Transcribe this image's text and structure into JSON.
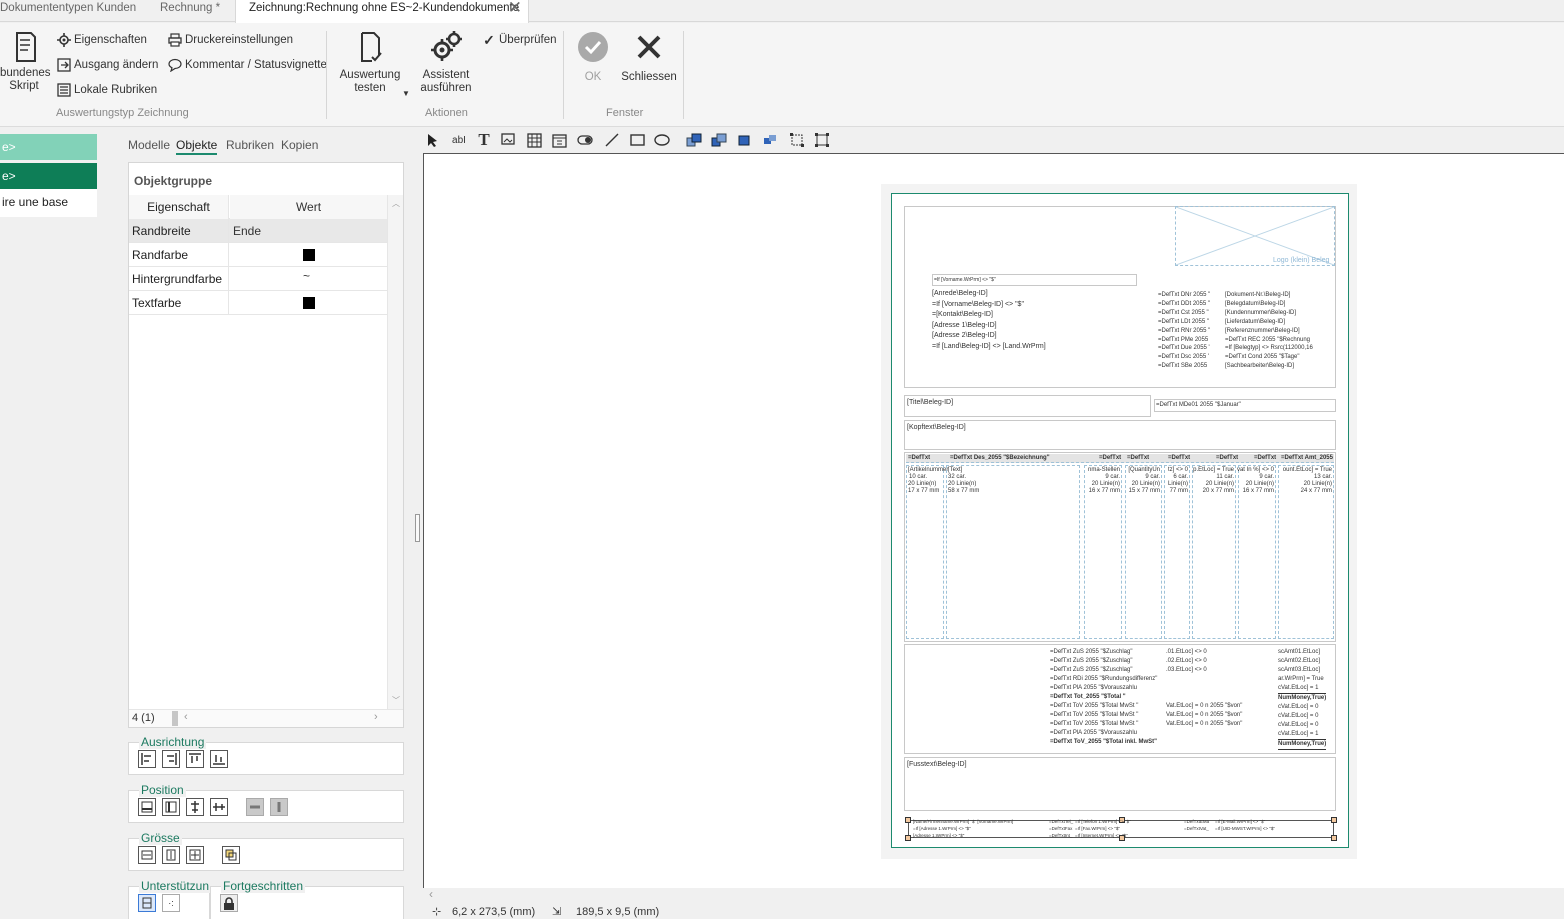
{
  "tabs": [
    {
      "label": "Dokumententypen Kunden"
    },
    {
      "label": "Rechnung *"
    },
    {
      "label": "Zeichnung:Rechnung ohne ES~2-Kundendokumente"
    }
  ],
  "ribbon": {
    "script_label": "bundenes\nSkript",
    "eigenschaften": "Eigenschaften",
    "ausgang_aendern": "Ausgang ändern",
    "lokale_rubriken": "Lokale Rubriken",
    "druckereinstellungen": "Druckereinstellungen",
    "kommentar": "Kommentar / Statusvignette",
    "group1": "Auswertungstyp Zeichnung",
    "auswertung_testen": "Auswertung\ntesten",
    "assistent": "Assistent\nausführen",
    "ueberpruefen": "Überprüfen",
    "group2": "Aktionen",
    "ok": "OK",
    "schliessen": "Schliessen",
    "group3": "Fenster"
  },
  "leftnav": {
    "item1": "e>",
    "item2": "e>",
    "item3": "ire une base"
  },
  "props": {
    "subtabs": [
      "Modelle",
      "Objekte",
      "Rubriken",
      "Kopien"
    ],
    "title": "Objektgruppe",
    "col_prop": "Eigenschaft",
    "col_val": "Wert",
    "rows": [
      {
        "name": "Randbreite",
        "value": "Ende"
      },
      {
        "name": "Randfarbe",
        "value": ""
      },
      {
        "name": "Hintergrundfarbe",
        "value": "~"
      },
      {
        "name": "Textfarbe",
        "value": ""
      }
    ],
    "counter": "4 (1)",
    "ausrichtung": "Ausrichtung",
    "position": "Position",
    "groesse": "Grösse",
    "unterstuetzung": "Unterstützun",
    "fortgeschritten": "Fortgeschritten"
  },
  "status": {
    "pos": "6,2 x 273,5 (mm)",
    "size": "189,5 x 9,5 (mm)"
  },
  "doc": {
    "logo": "Logo (klein) Beleg",
    "vorname_field": "=If [Vorname.WrPrm] <> \"$\"",
    "addr": [
      "[Anrede\\Beleg-ID]",
      "=If [Vorname\\Beleg-ID] <> \"$\"",
      "=[Kontakt\\Beleg-ID]",
      "[Adresse 1\\Beleg-ID]",
      "[Adresse 2\\Beleg-ID]",
      "=If [Land\\Beleg-ID] <> [Land.WrPrm]"
    ],
    "right_col1": [
      "=DefTxt DNr  2055 \"",
      "=DefTxt DDt  2055 \"",
      "=DefTxt Cst  2055 \"",
      "=DefTxt LDt  2055 \"",
      "=DefTxt RNr  2055 \"",
      "=DefTxt PMe  2055",
      "=DefTxt Due  2055 '",
      "=DefTxt Dsc  2055 '",
      "=DefTxt SBe  2055"
    ],
    "right_col2": [
      "[Dokument-Nr.\\Beleg-ID]",
      "[Belegdatum\\Beleg-ID]",
      "[Kundennummer\\Beleg-ID]",
      "[Lieferdatum\\Beleg-ID]",
      "[Referenznummer\\Beleg-ID]",
      "=DefTxt REC  2055 \"$Rechnung",
      "=If [Belegtyp] <> Rsrc(112000,16",
      "=DefTxt Cond  2055 \"$Tage\"",
      "[Sachbearbeiter\\Beleg-ID]"
    ],
    "titel": "[Titel\\Beleg-ID]",
    "mde": "=DefTxt MDe01  2055 \"$Januar\"",
    "kopftext": "[Kopftext\\Beleg-ID]",
    "table_headers": [
      "=DefTxt",
      "=DefTxt Des_2055 \"$Bezeichnung\"",
      "=DefTxt",
      "=DefTxt",
      "=DefTxt",
      "=DefTxt",
      "=DefTxt",
      "=DefTxt Amt_2055"
    ],
    "col_texts": [
      [
        "[Artikelnummer",
        "10 car.",
        "20 Linie(n)",
        "17 x 77 mm"
      ],
      [
        "[Text]",
        "32 car.",
        "20 Linie(n)",
        "58 x 77 mm"
      ],
      [
        "nma-Stellen",
        "9 car.",
        "20 Linie(n)",
        "16 x 77 mm"
      ],
      [
        "[QuantityUn",
        "9 car.",
        "20 Linie(n)",
        "15 x 77 mm"
      ],
      [
        "tz] <> 0",
        "6 car.",
        "Linie(n)",
        "77 mm"
      ],
      [
        "p.EtLoc] = True",
        "11 car.",
        "20 Linie(n)",
        "20 x 77 mm"
      ],
      [
        "vat In %] <> 0",
        "9 car.",
        "20 Linie(n)",
        "16 x 77 mm"
      ],
      [
        "ount.EtLoc] = True",
        "13 car.",
        "20 Linie(n)",
        "24 x 77 mm"
      ]
    ],
    "totals_left": [
      "=DefTxt ZuS  2055 \"$Zuschlag\"",
      "=DefTxt ZuS  2055 \"$Zuschlag\"",
      "=DefTxt ZuS  2055 \"$Zuschlag\"",
      "=DefTxt RDi  2055 \"$Rundungsdifferenz\"",
      "=DefTxt PlA  2055 \"$Vorauszahlu",
      "=DefTxt Tot_2055 \"$Total \"",
      "=DefTxt ToV  2055 \"$Total MwSt \"",
      "=DefTxt ToV  2055 \"$Total MwSt \"",
      "=DefTxt ToV  2055 \"$Total MwSt \"",
      "=DefTxt PlA  2055 \"$Vorauszahlu",
      "=DefTxt ToV_2055 \"$Total inkl. MwSt\""
    ],
    "totals_mid": [
      ".01.EtLoc] <> 0",
      ".02.EtLoc] <> 0",
      ".03.EtLoc] <> 0",
      "",
      "",
      "",
      "Vat.EtLoc] = 0     n  2055 \"$von\"",
      "Vat.EtLoc] = 0     n  2055 \"$von\"",
      "Vat.EtLoc] = 0     n  2055 \"$von\"",
      "",
      ""
    ],
    "totals_right": [
      "scAmt01.EtLoc]",
      "scAmt02.EtLoc]",
      "scAmt03.EtLoc]",
      "ar.WrPrm] = True",
      "cVat.EtLoc] = 1",
      "NumMoney,True)",
      "cVat.EtLoc] = 0",
      "cVat.EtLoc] = 0",
      "cVat.EtLoc] = 0",
      "cVat.EtLoc] = 1",
      "NumMoney,True)"
    ],
    "fusstext": "[Fusstext\\Beleg-ID]",
    "footer": [
      "[Name/Firmenname.WrPrm] \"$\" [Vorname.WrPrm]",
      "=If [Adresse 1.WrPrm] <> \"$\"",
      "[Adresse 1.WrPrm] <> \"$\"",
      "=DefTxtTel_",
      "=DefTxtFax",
      "=DefTxtInt_",
      "=If [Telefon 1.WrPrm] <> \"$\"",
      "=If [Fax.WrPrm] <> \"$\"",
      "=If [Internet.WrPrm] <> \"$\"",
      "=DefTxtEMa",
      "=DefTxtVat_",
      "=If [E-Mail.WrPrm] <> \"$\"",
      "=If [UID-MWST.WrPrm] <> \"$\""
    ]
  },
  "colors": {
    "accent": "#1c8a6e",
    "nav_active": "#0e7e57",
    "nav_light": "#82d2b8"
  }
}
